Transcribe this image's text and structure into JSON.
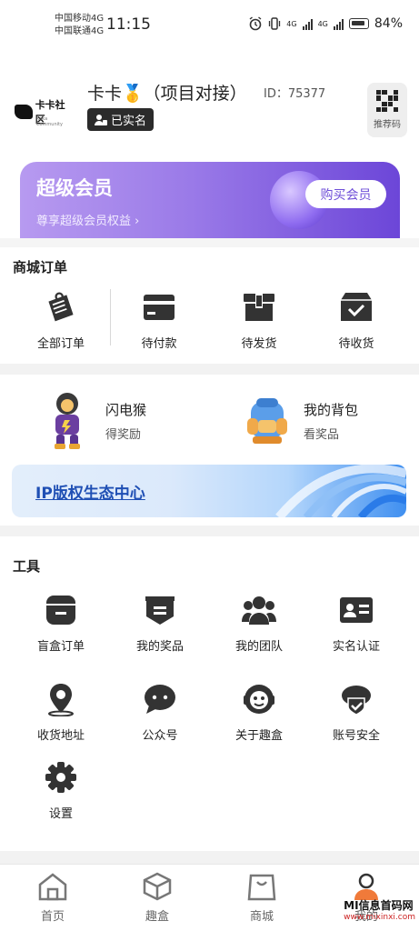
{
  "status": {
    "carrier1": "中国移动4G",
    "carrier2": "中国联通4G",
    "time": "11:15",
    "network1": "4G",
    "network2": "4G",
    "battery": "84%"
  },
  "profile": {
    "logo_text": "卡卡社区",
    "logo_sub": "Kaka Community",
    "name": "卡卡🥇（项目对接）",
    "id": "ID：75377",
    "verified": "已实名",
    "qr_label": "推荐码"
  },
  "vip": {
    "title": "超级会员",
    "subtitle": "尊享超级会员权益 ›",
    "buy": "购买会员"
  },
  "orders": {
    "title": "商城订单",
    "items": [
      {
        "label": "全部订单",
        "icon": "clipboard-icon"
      },
      {
        "label": "待付款",
        "icon": "wallet-icon"
      },
      {
        "label": "待发货",
        "icon": "package-icon"
      },
      {
        "label": "待收货",
        "icon": "box-check-icon"
      }
    ]
  },
  "promo": {
    "left": {
      "name": "闪电猴",
      "sub": "得奖励"
    },
    "right": {
      "name": "我的背包",
      "sub": "看奖品"
    },
    "banner": "IP版权生态中心"
  },
  "tools": {
    "title": "工具",
    "items": [
      {
        "label": "盲盒订单",
        "icon": "blind-box-icon"
      },
      {
        "label": "我的奖品",
        "icon": "prize-icon"
      },
      {
        "label": "我的团队",
        "icon": "team-icon"
      },
      {
        "label": "实名认证",
        "icon": "id-card-icon"
      },
      {
        "label": "收货地址",
        "icon": "location-icon"
      },
      {
        "label": "公众号",
        "icon": "chat-icon"
      },
      {
        "label": "关于趣盒",
        "icon": "mascot-icon"
      },
      {
        "label": "账号安全",
        "icon": "shield-icon"
      },
      {
        "label": "设置",
        "icon": "gear-icon"
      }
    ]
  },
  "tabs": [
    {
      "label": "首页",
      "icon": "home-icon"
    },
    {
      "label": "趣盒",
      "icon": "cube-icon"
    },
    {
      "label": "商城",
      "icon": "bag-icon"
    },
    {
      "label": "我的",
      "icon": "user-icon"
    }
  ],
  "watermark": {
    "text": "MI信息首码网",
    "url": "www.mixinxi.com"
  }
}
